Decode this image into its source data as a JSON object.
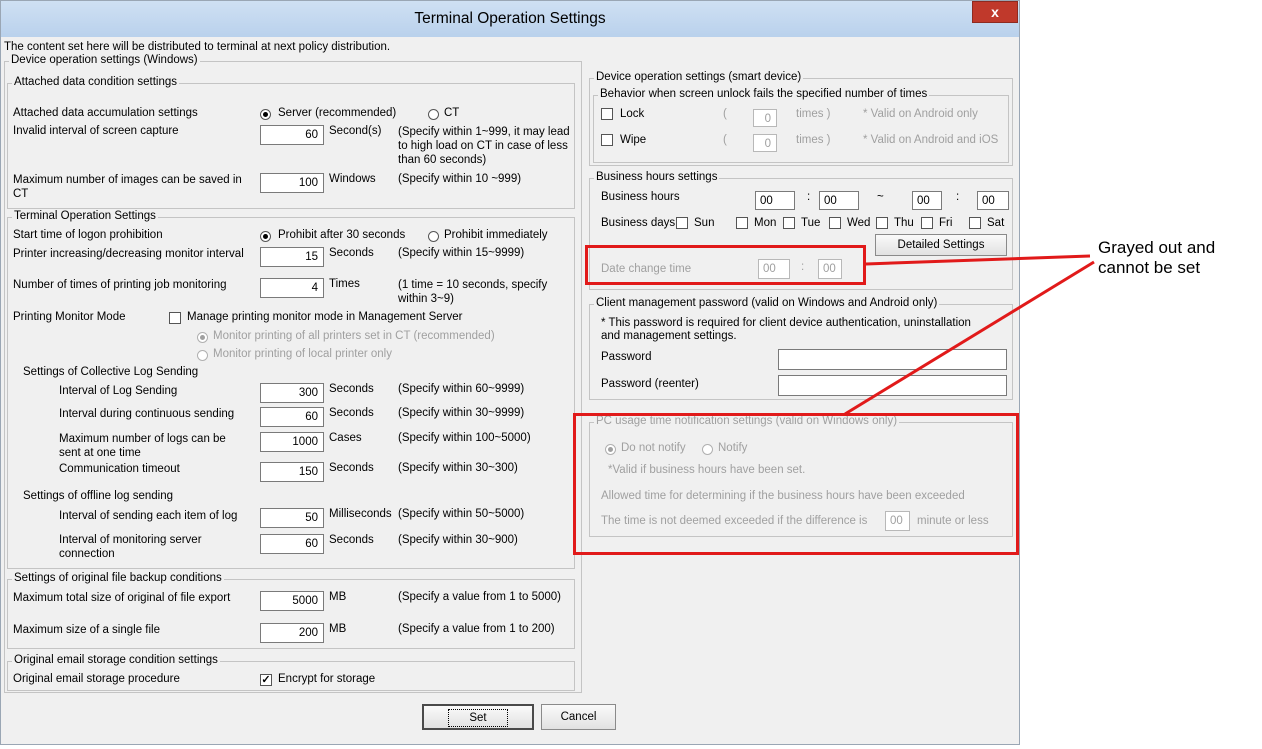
{
  "window": {
    "title": "Terminal Operation Settings",
    "close_label": "x",
    "notice": "The content set here will be distributed to terminal at next policy distribution."
  },
  "win_group": {
    "title": "Device operation settings (Windows)",
    "attached": {
      "title": "Attached data condition settings",
      "accumulation_label": "Attached data accumulation settings",
      "opt_server": "Server (recommended)",
      "opt_ct": "CT",
      "capture_label": "Invalid interval of screen capture",
      "capture_value": "60",
      "capture_unit": "Second(s)",
      "capture_note": "(Specify within 1~999, it may lead to high load on CT in case of less than 60 seconds)",
      "max_images_label": "Maximum number of images can be saved in CT",
      "max_images_value": "100",
      "max_images_unit": "Windows",
      "max_images_note": "(Specify within 10 ~999)"
    },
    "terminal": {
      "title": "Terminal Operation Settings",
      "logon_label": "Start time of logon prohibition",
      "opt_after30": "Prohibit after 30 seconds",
      "opt_immediate": "Prohibit immediately",
      "printer_interval_label": "Printer increasing/decreasing monitor interval",
      "printer_interval_value": "15",
      "printer_interval_unit": "Seconds",
      "printer_interval_note": "(Specify within 15~9999)",
      "printing_job_label": "Number of times of printing job monitoring",
      "printing_job_value": "4",
      "printing_job_unit": "Times",
      "printing_job_note": "(1 time = 10 seconds, specify within 3~9)",
      "printing_mode_label": "Printing Monitor Mode",
      "manage_mode_label": "Manage printing monitor mode in Management Server",
      "opt_all_printers": "Monitor printing of all printers set in CT (recommended)",
      "opt_local_printer": "Monitor printing of local printer only",
      "collective_title": "Settings of Collective Log Sending",
      "log_interval_label": "Interval of Log Sending",
      "log_interval_value": "300",
      "log_interval_unit": "Seconds",
      "log_interval_note": "(Specify within 60~9999)",
      "continuous_label": "Interval during continuous sending",
      "continuous_value": "60",
      "continuous_unit": "Seconds",
      "continuous_note": "(Specify within 30~9999)",
      "max_logs_label": "Maximum number of logs can be sent at one time",
      "max_logs_value": "1000",
      "max_logs_unit": "Cases",
      "max_logs_note": "(Specify within 100~5000)",
      "timeout_label": "Communication timeout",
      "timeout_value": "150",
      "timeout_unit": "Seconds",
      "timeout_note": "(Specify within 30~300)",
      "offline_title": "Settings of offline log sending",
      "item_interval_label": "Interval of sending each item of log",
      "item_interval_value": "50",
      "item_interval_unit": "Milliseconds",
      "item_interval_note": "(Specify within 50~5000)",
      "monitor_server_label": "Interval of monitoring server connection",
      "monitor_server_value": "60",
      "monitor_server_unit": "Seconds",
      "monitor_server_note": "(Specify within 30~900)"
    },
    "backup": {
      "title": "Settings of original file backup conditions",
      "max_total_label": "Maximum total size of original of file export",
      "max_total_value": "5000",
      "max_total_unit": "MB",
      "max_total_note": "(Specify a value from 1 to 5000)",
      "max_single_label": "Maximum size of a single file",
      "max_single_value": "200",
      "max_single_unit": "MB",
      "max_single_note": "(Specify a value from 1 to 200)"
    },
    "email": {
      "title": "Original email storage condition settings",
      "procedure_label": "Original email storage procedure",
      "encrypt_label": "Encrypt for storage"
    }
  },
  "smart": {
    "title": "Device operation settings (smart device)",
    "behavior_title": "Behavior when screen unlock fails the specified number of times",
    "lock_label": "Lock",
    "lock_value": "0",
    "lock_note": "* Valid on Android only",
    "wipe_label": "Wipe",
    "wipe_value": "0",
    "wipe_note": "* Valid on Android and iOS",
    "paren_open": "(",
    "times_label": "times )"
  },
  "business": {
    "title": "Business hours settings",
    "hours_label": "Business hours",
    "start_h": "00",
    "start_m": "00",
    "end_h": "00",
    "end_m": "00",
    "colon": ":",
    "tilde": "~",
    "days_label": "Business days",
    "days": [
      "Sun",
      "Mon",
      "Tue",
      "Wed",
      "Thu",
      "Fri",
      "Sat"
    ],
    "detailed_button": "Detailed Settings",
    "date_change_label": "Date change time",
    "date_change_h": "00",
    "date_change_m": "00"
  },
  "client": {
    "title": "Client management password (valid on Windows and Android only)",
    "note": "* This password is required for client device authentication, uninstallation and management settings.",
    "password_label": "Password",
    "password_value": "",
    "reenter_label": "Password (reenter)",
    "reenter_value": ""
  },
  "pc_usage": {
    "title": "PC usage time notification settings (valid on Windows only)",
    "opt_not_notify": "Do not notify",
    "opt_notify": "Notify",
    "valid_note": "*Valid if business hours have been set.",
    "allowed_label": "Allowed time for determining if the business hours have been exceeded",
    "exceed_prefix": "The time is not deemed exceeded if the difference is",
    "exceed_value": "00",
    "exceed_suffix": "minute or less"
  },
  "footer": {
    "set_button": "Set",
    "cancel_button": "Cancel"
  },
  "annotation": {
    "line1": "Grayed out and",
    "line2": "cannot be set"
  },
  "colors": {
    "highlight": "#e11a1a",
    "titlebar": "#c4d8f0",
    "close_button": "#c0392b"
  }
}
